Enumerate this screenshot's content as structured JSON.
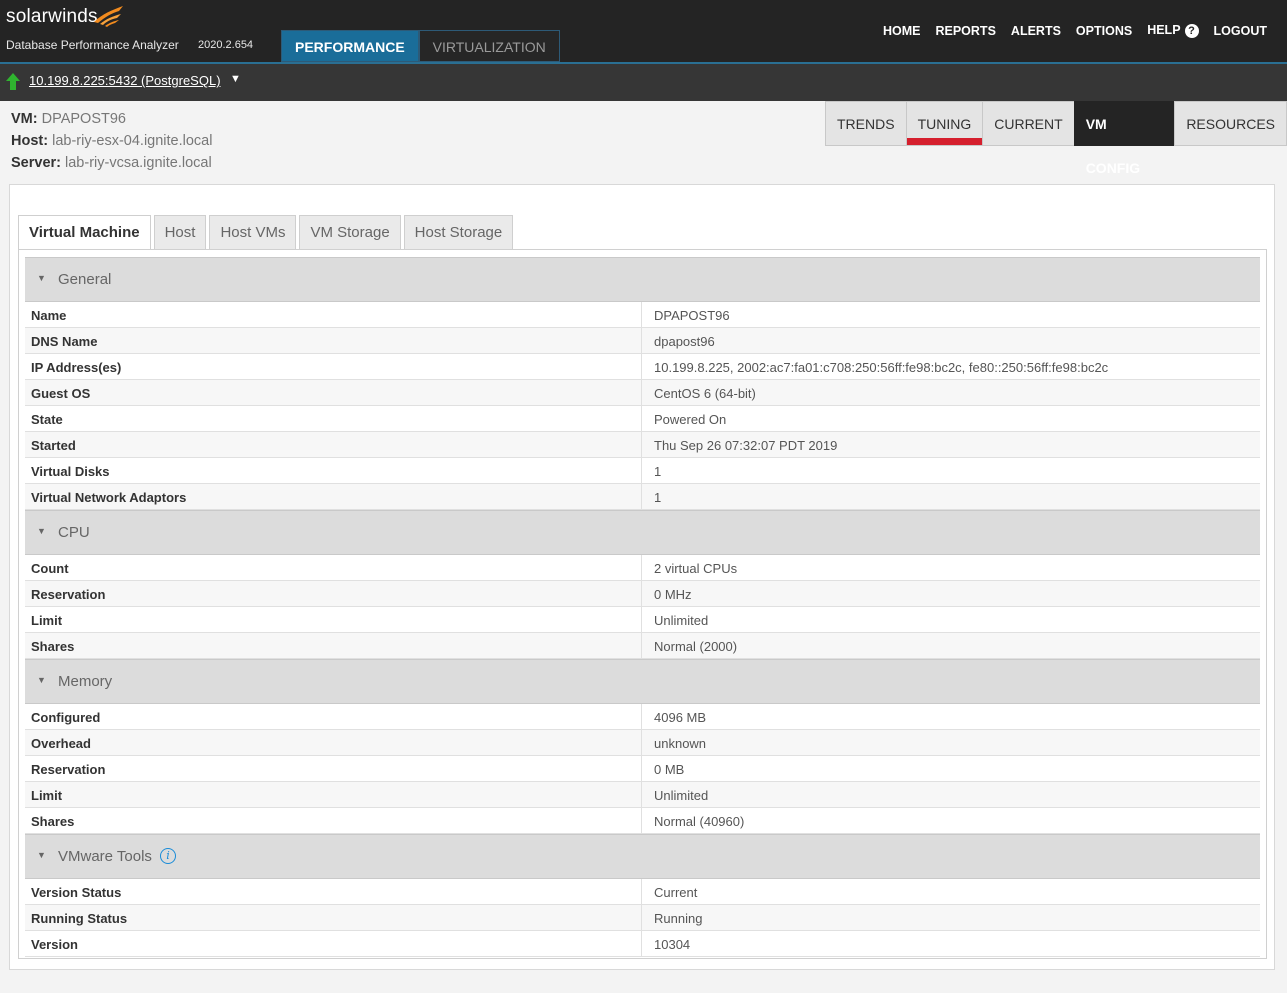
{
  "brand": {
    "logo_text": "solarwinds",
    "product": "Database Performance Analyzer",
    "version": "2020.2.654"
  },
  "main_tabs": [
    {
      "label": "PERFORMANCE",
      "active": true
    },
    {
      "label": "VIRTUALIZATION",
      "active": false
    }
  ],
  "top_menu": {
    "home": "HOME",
    "reports": "REPORTS",
    "alerts": "ALERTS",
    "options": "OPTIONS",
    "help": "HELP",
    "logout": "LOGOUT"
  },
  "db_instance": {
    "label": "10.199.8.225:5432 (PostgreSQL)",
    "status_color": "#2fb42f"
  },
  "vm_info": {
    "vm_label": "VM:",
    "vm_value": "DPAPOST96",
    "host_label": "Host:",
    "host_value": "lab-riy-esx-04.ignite.local",
    "server_label": "Server:",
    "server_value": "lab-riy-vcsa.ignite.local"
  },
  "sub_nav": {
    "trends": "TRENDS",
    "tuning": "TUNING",
    "current": "CURRENT",
    "vm_config": "VM CONFIG",
    "resources": "RESOURCES",
    "active": "VM CONFIG",
    "accent_color": "#d51f2d"
  },
  "tabs": {
    "virtual_machine": "Virtual Machine",
    "host": "Host",
    "host_vms": "Host VMs",
    "vm_storage": "VM Storage",
    "host_storage": "Host Storage",
    "active": "Virtual Machine"
  },
  "sections": {
    "general": {
      "title": "General",
      "rows": [
        {
          "key": "Name",
          "value": "DPAPOST96"
        },
        {
          "key": "DNS Name",
          "value": "dpapost96"
        },
        {
          "key": "IP Address(es)",
          "value": "10.199.8.225, 2002:ac7:fa01:c708:250:56ff:fe98:bc2c, fe80::250:56ff:fe98:bc2c"
        },
        {
          "key": "Guest OS",
          "value": "CentOS 6 (64-bit)"
        },
        {
          "key": "State",
          "value": "Powered On"
        },
        {
          "key": "Started",
          "value": "Thu Sep 26 07:32:07 PDT 2019"
        },
        {
          "key": "Virtual Disks",
          "value": "1"
        },
        {
          "key": "Virtual Network Adaptors",
          "value": "1"
        }
      ]
    },
    "cpu": {
      "title": "CPU",
      "rows": [
        {
          "key": "Count",
          "value": "2 virtual CPUs"
        },
        {
          "key": "Reservation",
          "value": "0 MHz"
        },
        {
          "key": "Limit",
          "value": "Unlimited"
        },
        {
          "key": "Shares",
          "value": "Normal (2000)"
        }
      ]
    },
    "memory": {
      "title": "Memory",
      "rows": [
        {
          "key": "Configured",
          "value": "4096 MB"
        },
        {
          "key": "Overhead",
          "value": "unknown"
        },
        {
          "key": "Reservation",
          "value": "0 MB"
        },
        {
          "key": "Limit",
          "value": "Unlimited"
        },
        {
          "key": "Shares",
          "value": "Normal (40960)"
        }
      ]
    },
    "vmware_tools": {
      "title": "VMware Tools",
      "info_icon": "info-icon",
      "rows": [
        {
          "key": "Version Status",
          "value": "Current"
        },
        {
          "key": "Running Status",
          "value": "Running"
        },
        {
          "key": "Version",
          "value": "10304"
        }
      ]
    }
  }
}
